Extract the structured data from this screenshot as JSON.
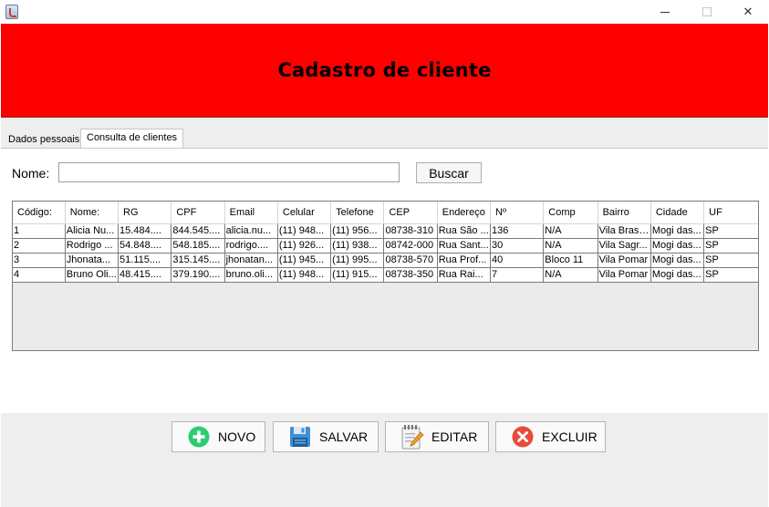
{
  "window": {
    "minimize": "",
    "maximize": "",
    "close": "✕"
  },
  "header": {
    "title": "Cadastro de cliente",
    "color": "#ff0000"
  },
  "tabs": [
    {
      "label": "Dados pessoais",
      "selected": false
    },
    {
      "label": "Consulta de clientes",
      "selected": true
    }
  ],
  "search": {
    "label": "Nome:",
    "value": "",
    "button": "Buscar"
  },
  "table": {
    "columns": [
      "Código:",
      "Nome:",
      "RG",
      "CPF",
      "Email",
      "Celular",
      "Telefone",
      "CEP",
      "Endereço",
      "Nº",
      "Comp",
      "Bairro",
      "Cidade",
      "UF"
    ],
    "rows": [
      [
        "1",
        "Alicia Nu...",
        "15.484....",
        "844.545....",
        "alicia.nu...",
        "(11) 948...",
        "(11) 956...",
        "08738-310",
        "Rua São ...",
        "136",
        "N/A",
        "Vila Brasi...",
        "Mogi das...",
        "SP"
      ],
      [
        "2",
        "Rodrigo ...",
        "54.848....",
        "548.185....",
        "rodrigo....",
        "(11) 926...",
        "(11) 938...",
        "08742-000",
        "Rua Sant...",
        "30",
        "N/A",
        "Vila Sagr...",
        "Mogi das...",
        "SP"
      ],
      [
        "3",
        "Jhonata...",
        "51.115....",
        "315.145....",
        "jhonatan...",
        "(11) 945...",
        "(11) 995...",
        "08738-570",
        "Rua Prof...",
        "40",
        "Bloco 11",
        "Vila Pomar",
        "Mogi das...",
        "SP"
      ],
      [
        "4",
        "Bruno Oli...",
        "48.415....",
        "379.190....",
        "bruno.oli...",
        "(11) 948...",
        "(11) 915...",
        "08738-350",
        "Rua Rai...",
        "7",
        "N/A",
        "Vila Pomar",
        "Mogi das...",
        "SP"
      ]
    ]
  },
  "actions": {
    "novo": {
      "label": "NOVO",
      "icon": "plus-circle-icon",
      "color": "#2ecc71"
    },
    "salvar": {
      "label": "SALVAR",
      "icon": "floppy-disk-icon",
      "color": "#3b8fd6"
    },
    "editar": {
      "label": "EDITAR",
      "icon": "notepad-pencil-icon",
      "color": "#f0a030"
    },
    "excluir": {
      "label": "EXCLUIR",
      "icon": "x-circle-icon",
      "color": "#e74c3c"
    }
  }
}
